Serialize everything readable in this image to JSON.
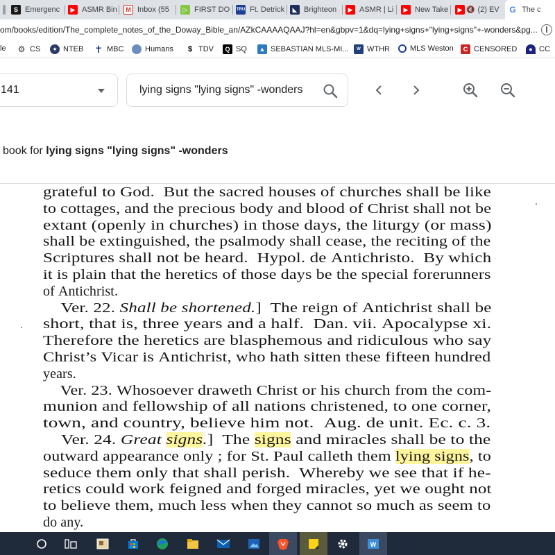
{
  "browser": {
    "tabs": [
      {
        "title": "",
        "icon": "tab-edge-icon",
        "color": "#9aa0a6"
      },
      {
        "title": "Emergenc",
        "icon": "s-logo-icon",
        "color": "#1a1a1a"
      },
      {
        "title": "ASMR Bin",
        "icon": "youtube-icon",
        "color": "#ff0000"
      },
      {
        "title": "Inbox (55",
        "icon": "gmail-icon",
        "color": "#d93025"
      },
      {
        "title": "FIRST DO",
        "icon": "rumble-icon",
        "color": "#85c742"
      },
      {
        "title": "Ft. Detrick",
        "icon": "news-icon",
        "color": "#1c3f94"
      },
      {
        "title": "Brighteon",
        "icon": "brighteon-icon",
        "color": "#1c2e59"
      },
      {
        "title": "ASMR | Li",
        "icon": "youtube-icon",
        "color": "#ff0000"
      },
      {
        "title": "New Take",
        "icon": "youtube-icon",
        "color": "#ff0000"
      },
      {
        "title": "(2) EV",
        "icon": "youtube-icon",
        "color": "#ff0000"
      },
      {
        "title": "The c",
        "icon": "google-icon",
        "color": "#4285f4"
      }
    ],
    "url": "om/books/edition/The_complete_notes_of_the_Doway_Bible_an/AZkCAAAAQAAJ?hl=en&gbpv=1&dq=lying+signs+\"lying+signs\"+-wonders&pg...",
    "bookmarks": [
      {
        "label": "le",
        "icon": "folder-icon"
      },
      {
        "label": "CS",
        "icon": "bike-icon"
      },
      {
        "label": "NTEB",
        "icon": "nteb-icon"
      },
      {
        "label": "MBC",
        "icon": "cross-icon"
      },
      {
        "label": "Humans",
        "icon": "globe-icon"
      },
      {
        "label": "TDV",
        "icon": "tdv-icon"
      },
      {
        "label": "SQ",
        "icon": "q-icon"
      },
      {
        "label": "SEBASTIAN MLS-MI...",
        "icon": "mls-icon"
      },
      {
        "label": "WTHR",
        "icon": "wthr-icon"
      },
      {
        "label": "MLS Weston",
        "icon": "mls-pin-icon"
      },
      {
        "label": "CENSORED",
        "icon": "censored-icon"
      },
      {
        "label": "CC",
        "icon": "cc-icon"
      }
    ]
  },
  "books": {
    "page_value": "141",
    "search_query": "lying signs \"lying signs\" -wonders",
    "results_prefix": "book for",
    "results_query": "lying signs \"lying signs\" -wonders"
  },
  "scan": {
    "lines": [
      [
        {
          "t": "grateful to God.  But the sacred houses of churches shall be like"
        }
      ],
      [
        {
          "t": "to cottages, and the precious body and blood of Christ shall not be"
        }
      ],
      [
        {
          "t": "extant (openly in churches) in those days, the liturgy (or mass)"
        }
      ],
      [
        {
          "t": "shall be extinguished, the psalmody shall cease, the reciting of the"
        }
      ],
      [
        {
          "t": "Scriptures shall not be heard.  Hypol. de Antichristo.  By which"
        }
      ],
      [
        {
          "t": "it is plain that the heretics of those days be the special forerunners"
        }
      ],
      [
        {
          "t": "of Antichrist."
        }
      ],
      [
        {
          "t": "    Ver. 22. "
        },
        {
          "t": "Shall be shortened.",
          "i": true
        },
        {
          "t": "]  The reign of Antichrist shall be"
        }
      ],
      [
        {
          "t": "short, that is, three years and a half.  Dan. vii. Apocalypse xi."
        }
      ],
      [
        {
          "t": "Therefore the heretics are blasphemous and ridiculous who say"
        }
      ],
      [
        {
          "t": "Christ’s Vicar is Antichrist, who hath sitten these fifteen hundred"
        }
      ],
      [
        {
          "t": "years."
        }
      ],
      [
        {
          "t": "    Ver. 23. Whosoever draweth Christ or his church from the com-"
        }
      ],
      [
        {
          "t": "munion and fellowship of all nations christened, to one corner,"
        }
      ],
      [
        {
          "t": "town, and country, believe him not.  Aug. de unit. Ec. c. 3."
        }
      ],
      [
        {
          "t": "    Ver. 24. "
        },
        {
          "t": "Great ",
          "i": true
        },
        {
          "t": "signs",
          "i": true,
          "h": true
        },
        {
          "t": ".",
          "i": true
        },
        {
          "t": "]  The "
        },
        {
          "t": "signs",
          "h": true
        },
        {
          "t": " and miracles shall be to the"
        }
      ],
      [
        {
          "t": "outward appearance only ; for St. Paul calleth them "
        },
        {
          "t": "lying signs",
          "h": true
        },
        {
          "t": ", to"
        }
      ],
      [
        {
          "t": "seduce them only that shall perish.  Whereby we see that if he-"
        }
      ],
      [
        {
          "t": "retics could work feigned and forged miracles, yet we ought not"
        }
      ],
      [
        {
          "t": "to believe them, much less when they cannot so much as seem to"
        }
      ],
      [
        {
          "t": "do any."
        }
      ]
    ]
  },
  "taskbar": {
    "items": [
      "start-circle-icon",
      "task-view-icon",
      "app-thumbnail-icon",
      "store-icon",
      "edge-icon",
      "file-explorer-icon",
      "mail-icon",
      "photos-icon",
      "brave-icon",
      "sticky-notes-icon",
      "settings-icon",
      "vs-icon"
    ]
  },
  "colors": {
    "highlight": "#fff59d",
    "taskbar": "#1f2a3a",
    "tabstrip": "#dee1e6"
  }
}
